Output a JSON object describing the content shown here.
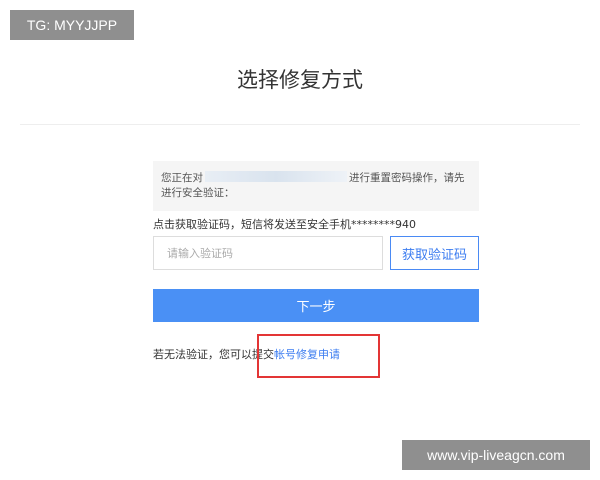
{
  "watermark": {
    "top_left": "TG: MYYJJPP",
    "bottom_right": "www.vip-liveagcn.com"
  },
  "page": {
    "title": "选择修复方式"
  },
  "notice": {
    "prefix": "您正在对",
    "suffix": "进行重置密码操作，请先",
    "line2": "进行安全验证："
  },
  "sms": {
    "info": "点击获取验证码，短信将发送至安全手机********940"
  },
  "code_field": {
    "value": "",
    "placeholder": "请输入验证码"
  },
  "buttons": {
    "get_code": "获取验证码",
    "next": "下一步"
  },
  "fallback": {
    "text": "若无法验证，您可以提交",
    "link": "帐号修复申请"
  },
  "colors": {
    "accent": "#4a90f5",
    "link": "#3b7cf0",
    "highlight": "#e33535"
  }
}
